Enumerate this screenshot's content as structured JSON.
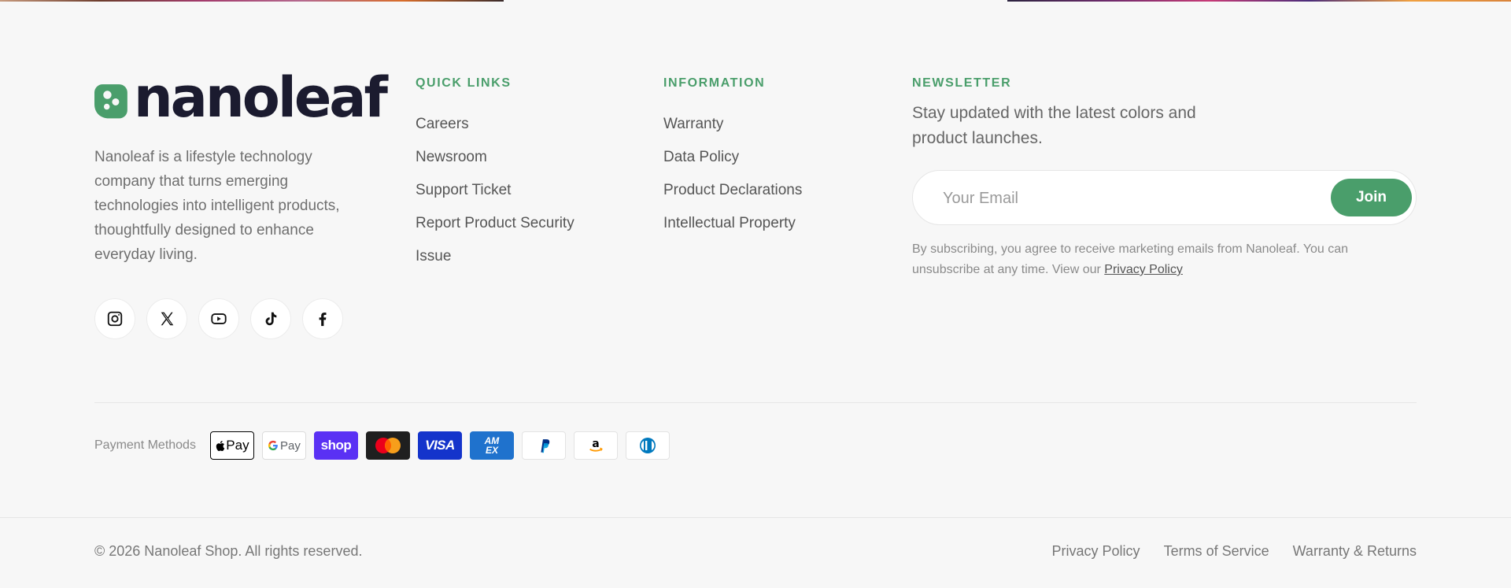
{
  "brand": {
    "name": "nanoleaf",
    "logo_color": "#4a9e6b",
    "description": "Nanoleaf is a lifestyle technology company that turns emerging technologies into intelligent products, thoughtfully designed to enhance everyday living."
  },
  "socials": [
    {
      "name": "instagram-icon"
    },
    {
      "name": "x-icon"
    },
    {
      "name": "youtube-icon"
    },
    {
      "name": "tiktok-icon"
    },
    {
      "name": "facebook-icon"
    }
  ],
  "quick_links": {
    "title": "QUICK LINKS",
    "items": [
      "Careers",
      "Newsroom",
      "Support Ticket",
      "Report Product Security Issue"
    ]
  },
  "information": {
    "title": "INFORMATION",
    "items": [
      "Warranty",
      "Data Policy",
      "Product Declarations",
      "Intellectual Property"
    ]
  },
  "newsletter": {
    "title": "NEWSLETTER",
    "text": "Stay updated with the latest colors and product launches.",
    "email_placeholder": "Your Email",
    "email_value": "",
    "join_label": "Join",
    "disclaimer_prefix": "By subscribing, you agree to receive marketing emails from Nanoleaf. You can unsubscribe at any time. View our ",
    "privacy_link": "Privacy Policy"
  },
  "payments": {
    "label": "Payment Methods",
    "methods": [
      {
        "name": "Apple Pay",
        "text": "Pay",
        "icon": "apple-icon",
        "bg": "#ffffff",
        "fg": "#000000",
        "border": "#000000"
      },
      {
        "name": "Google Pay",
        "text": "Pay",
        "icon": "google-icon",
        "bg": "#ffffff",
        "fg": "#5f6368",
        "border": "#dcdcdc"
      },
      {
        "name": "Shop Pay",
        "text": "shop",
        "bg": "#5a31f4",
        "fg": "#ffffff",
        "border": "#5a31f4"
      },
      {
        "name": "Mastercard",
        "icon": "mastercard-icon",
        "bg": "#1f1f1f",
        "fg": "#ffffff",
        "border": "#1f1f1f"
      },
      {
        "name": "Visa",
        "text": "VISA",
        "bg": "#1434cb",
        "fg": "#ffffff",
        "border": "#1434cb"
      },
      {
        "name": "American Express",
        "text": "AM EX",
        "bg": "#1f72cd",
        "fg": "#ffffff",
        "border": "#1f72cd"
      },
      {
        "name": "PayPal",
        "icon": "paypal-icon",
        "bg": "#ffffff",
        "fg": "#003087",
        "border": "#e3e3e3"
      },
      {
        "name": "Amazon Pay",
        "icon": "amazon-icon",
        "bg": "#ffffff",
        "fg": "#000000",
        "border": "#e3e3e3"
      },
      {
        "name": "Diners Club",
        "icon": "diners-icon",
        "bg": "#ffffff",
        "fg": "#0079be",
        "border": "#e3e3e3"
      }
    ]
  },
  "footer": {
    "copyright": "© 2026 Nanoleaf Shop. All rights reserved.",
    "links": [
      "Privacy Policy",
      "Terms of Service",
      "Warranty & Returns"
    ]
  },
  "colors": {
    "accent": "#4a9e6b",
    "background": "#f7f7f7",
    "text": "#555555"
  }
}
